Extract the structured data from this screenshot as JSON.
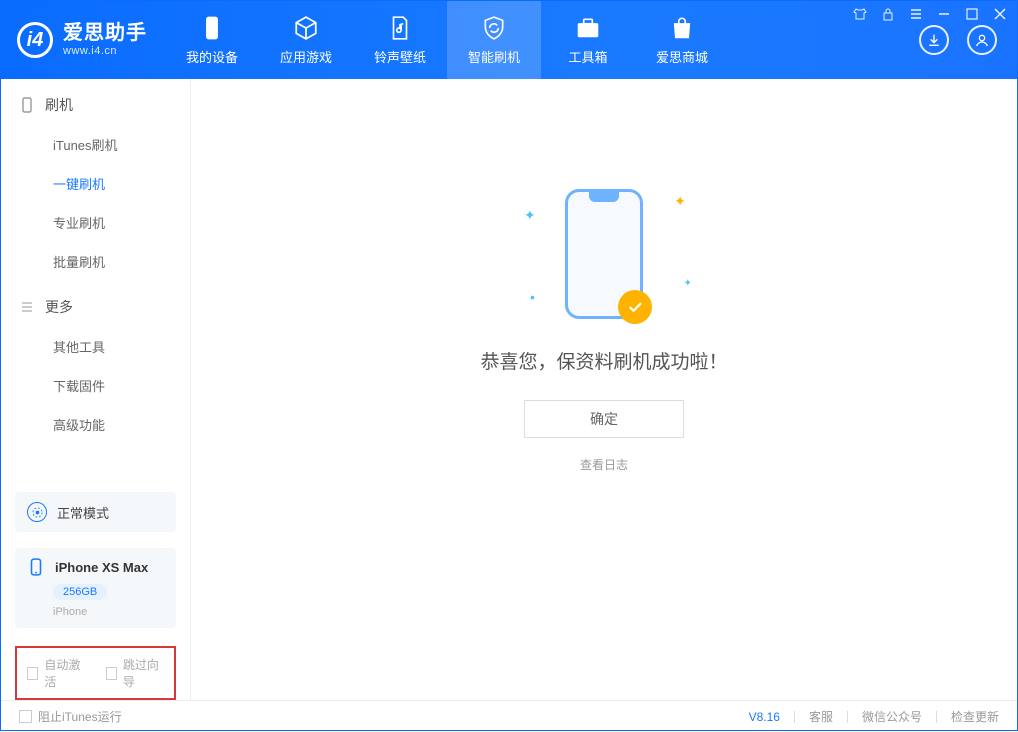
{
  "app": {
    "title": "爱思助手",
    "subtitle": "www.i4.cn"
  },
  "tabs": {
    "device": "我的设备",
    "games": "应用游戏",
    "ringtones": "铃声壁纸",
    "flash": "智能刷机",
    "toolbox": "工具箱",
    "store": "爱思商城"
  },
  "sidebar": {
    "section_flash": "刷机",
    "items_flash": {
      "itunes": "iTunes刷机",
      "oneclick": "一键刷机",
      "pro": "专业刷机",
      "batch": "批量刷机"
    },
    "section_more": "更多",
    "items_more": {
      "other_tools": "其他工具",
      "download_fw": "下载固件",
      "advanced": "高级功能"
    }
  },
  "device_panel": {
    "mode": "正常模式",
    "device_name": "iPhone XS Max",
    "storage": "256GB",
    "device_type": "iPhone"
  },
  "checkboxes": {
    "auto_activate": "自动激活",
    "skip_guide": "跳过向导"
  },
  "main": {
    "success_message": "恭喜您，保资料刷机成功啦！",
    "ok_button": "确定",
    "view_log": "查看日志"
  },
  "footer": {
    "block_itunes": "阻止iTunes运行",
    "version": "V8.16",
    "support": "客服",
    "wechat": "微信公众号",
    "check_update": "检查更新"
  }
}
